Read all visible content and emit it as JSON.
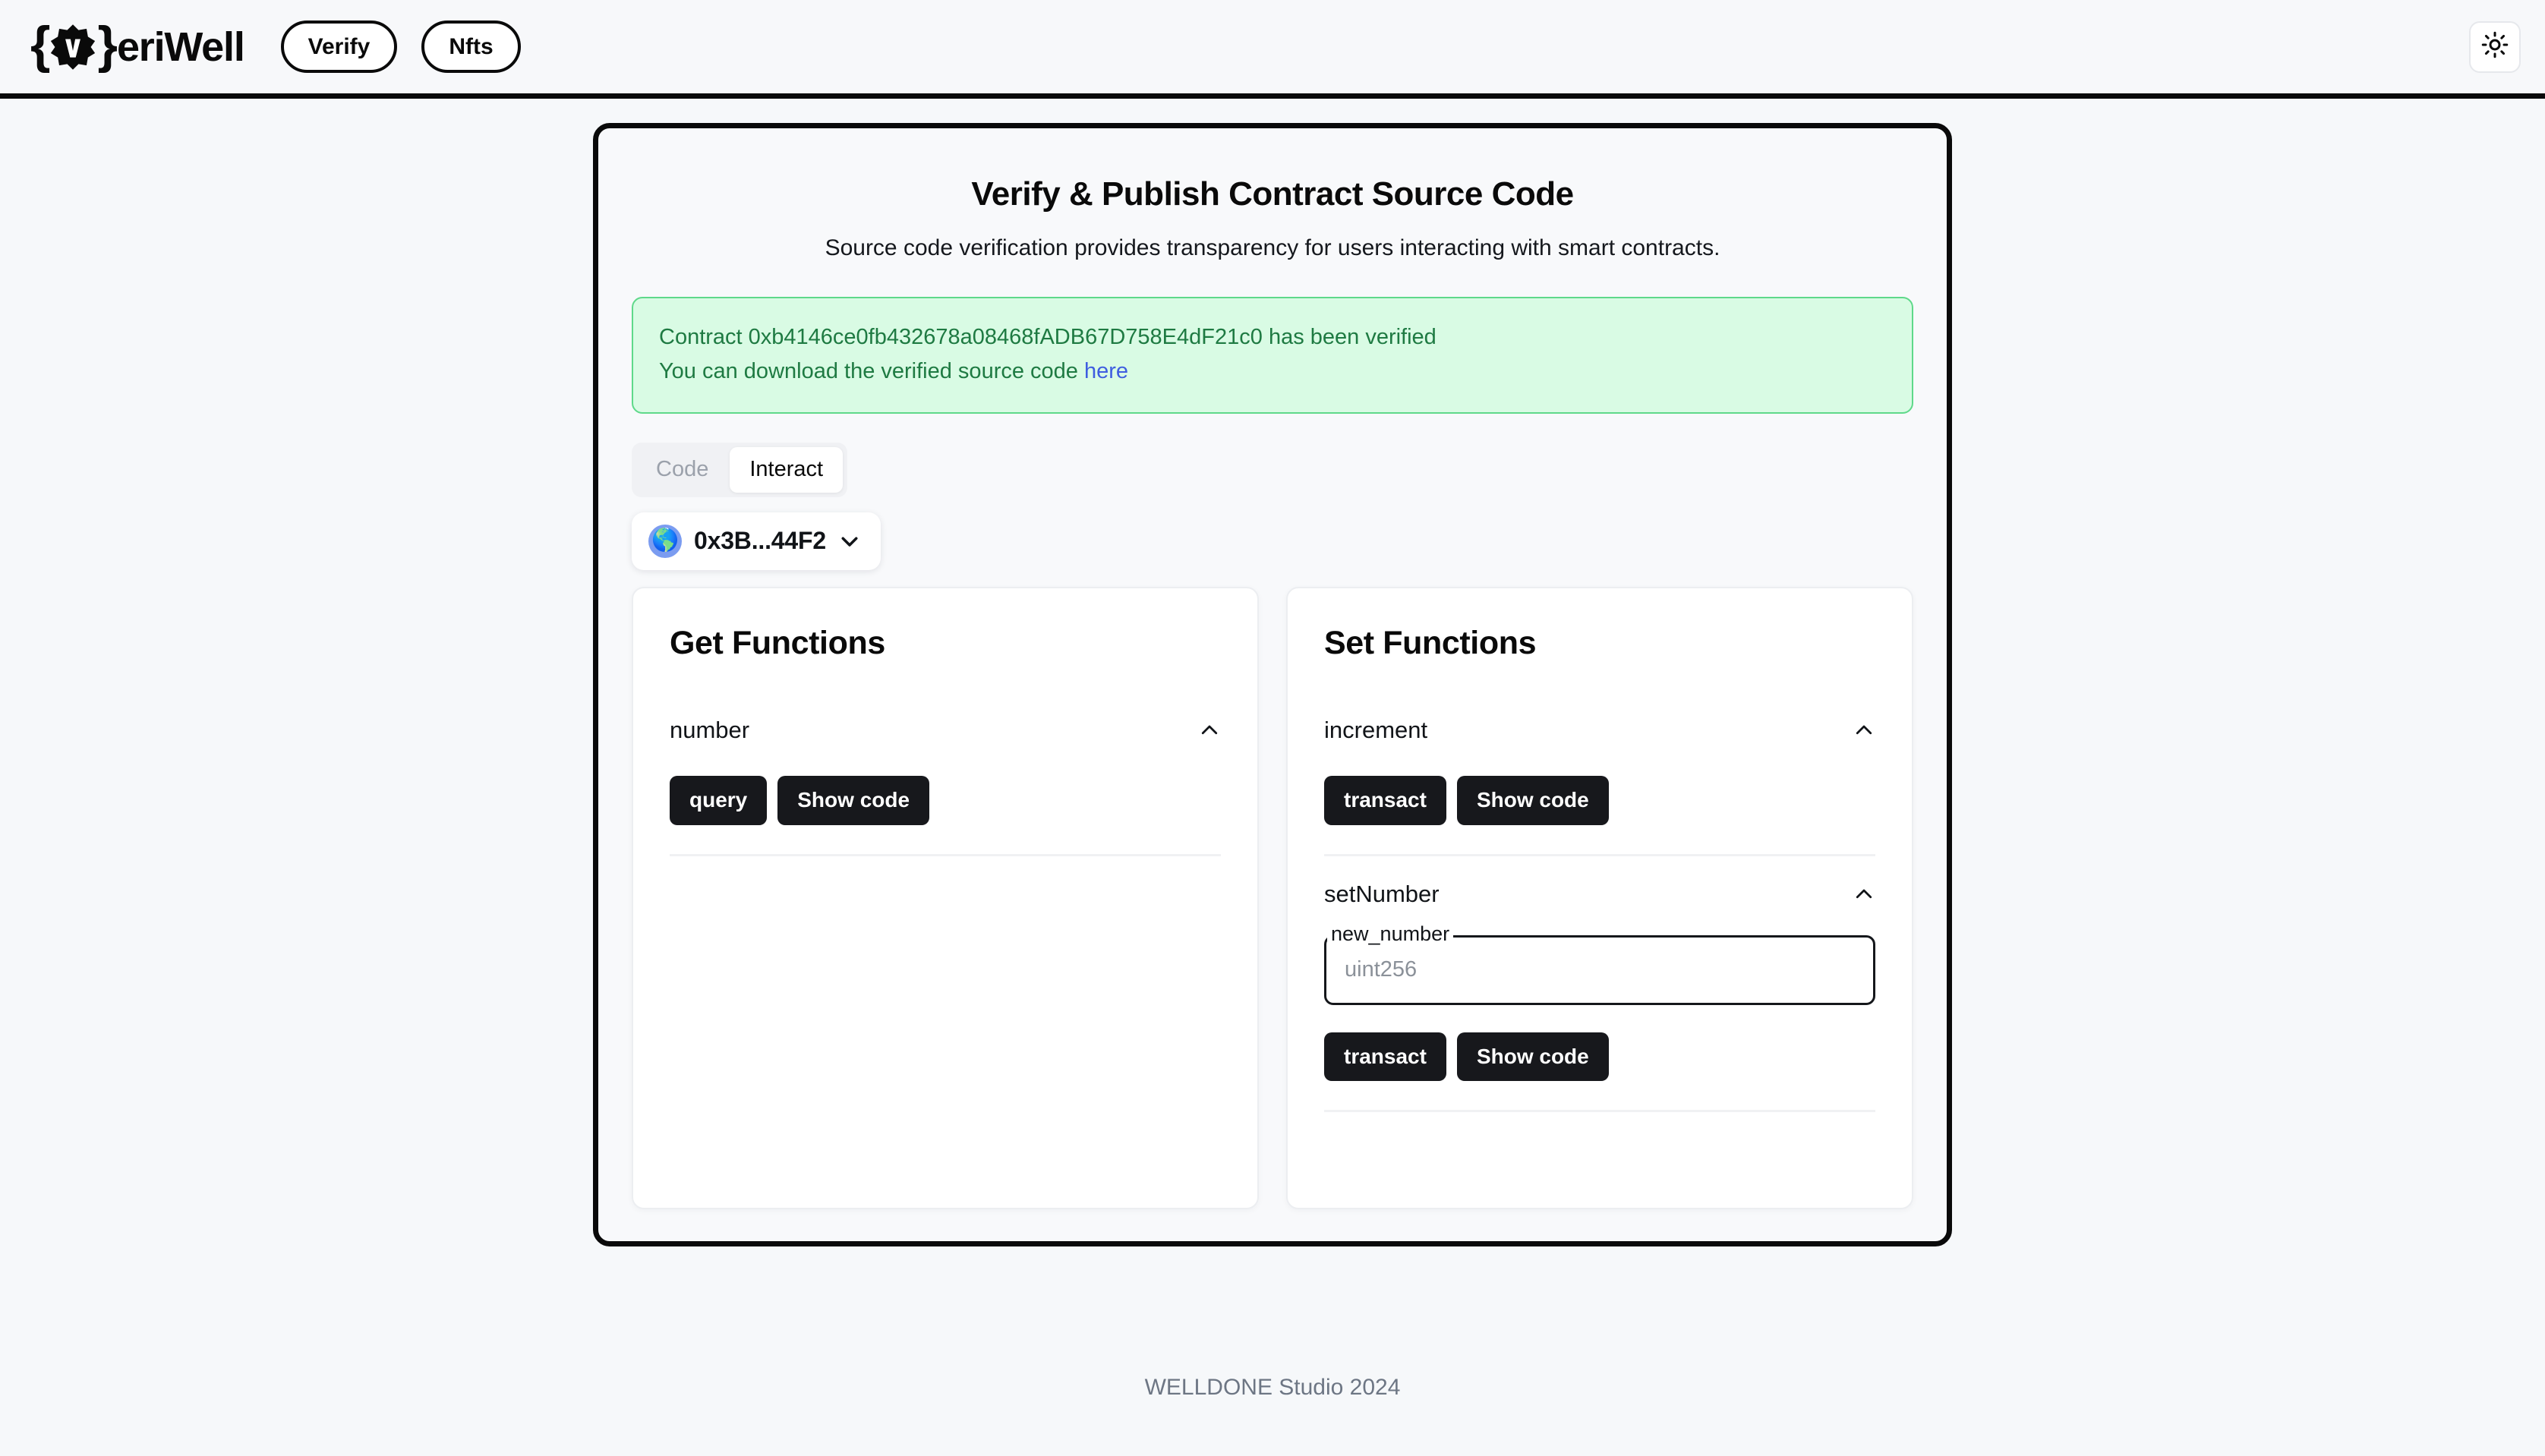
{
  "header": {
    "brand": {
      "brace_open": "{",
      "brace_close": "}",
      "star_letter": "V",
      "word": "eriWell"
    },
    "nav": [
      {
        "label": "Verify",
        "name": "nav-verify"
      },
      {
        "label": "Nfts",
        "name": "nav-nfts"
      }
    ],
    "theme_toggle_icon": "sun-icon"
  },
  "card": {
    "title": "Verify & Publish Contract Source Code",
    "subtitle": "Source code verification provides transparency for users interacting with smart contracts.",
    "alert": {
      "line1": "Contract 0xb4146ce0fb432678a08468fADB67D758E4dF21c0 has been verified",
      "line2_prefix": "You can download the verified source code ",
      "line2_link": "here",
      "contract_address": "0xb4146ce0fb432678a08468fADB67D758E4dF21c0",
      "bg_color": "#d9fbe4",
      "border_color": "#5fd98a",
      "text_color": "#1e7a42",
      "link_color": "#3e5de0"
    },
    "tabs": [
      {
        "label": "Code",
        "active": false
      },
      {
        "label": "Interact",
        "active": true
      }
    ],
    "account": {
      "avatar_icon": "globe-icon",
      "avatar_glyph": "🌎",
      "address": "0x3B...44F2",
      "chevron": "chevron-down-icon"
    }
  },
  "panels": {
    "get": {
      "title": "Get Functions",
      "functions": [
        {
          "name": "number",
          "expanded": true,
          "chevron": "chevron-up-icon",
          "inputs": [],
          "actions": [
            {
              "label": "query",
              "name": "query-button"
            },
            {
              "label": "Show code",
              "name": "show-code-button"
            }
          ]
        }
      ]
    },
    "set": {
      "title": "Set Functions",
      "functions": [
        {
          "name": "increment",
          "expanded": true,
          "chevron": "chevron-up-icon",
          "inputs": [],
          "actions": [
            {
              "label": "transact",
              "name": "transact-button"
            },
            {
              "label": "Show code",
              "name": "show-code-button"
            }
          ]
        },
        {
          "name": "setNumber",
          "expanded": true,
          "chevron": "chevron-up-icon",
          "inputs": [
            {
              "label": "new_number",
              "placeholder": "uint256",
              "value": ""
            }
          ],
          "actions": [
            {
              "label": "transact",
              "name": "transact-button"
            },
            {
              "label": "Show code",
              "name": "show-code-button"
            }
          ]
        }
      ]
    }
  },
  "footer": {
    "text": "WELLDONE Studio 2024"
  },
  "theme": {
    "page_bg": "#f6f8fa",
    "card_bg": "#f8f9fb",
    "panel_bg": "#ffffff",
    "ink": "#0a0a0a",
    "button_dark": "#17181c",
    "muted": "#6d7684"
  }
}
